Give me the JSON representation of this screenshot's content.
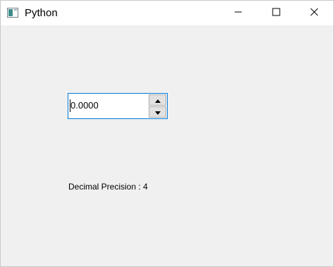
{
  "window": {
    "title": "Python",
    "icon": "python-app-icon",
    "controls": [
      "minimize-icon",
      "maximize-icon",
      "close-icon"
    ]
  },
  "spinbox": {
    "value": "0.0000"
  },
  "label": {
    "text": "Decimal Precision : 4"
  },
  "colors": {
    "titlebar_bg": "#ffffff",
    "client_bg": "#f0f0f0",
    "focus_border": "#0078d7"
  }
}
